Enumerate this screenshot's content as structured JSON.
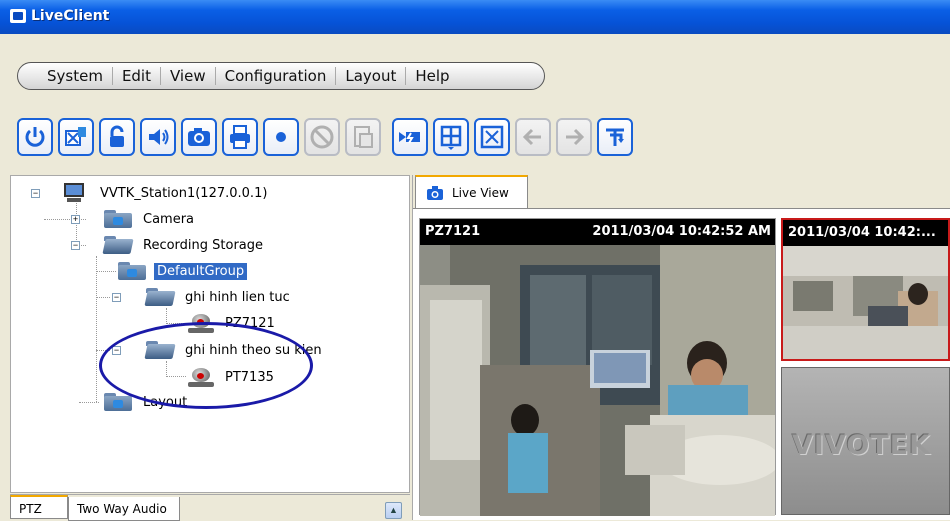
{
  "window": {
    "title": "LiveClient"
  },
  "menu": [
    "System",
    "Edit",
    "View",
    "Configuration",
    "Layout",
    "Help"
  ],
  "toolbar": {
    "buttons": [
      {
        "icon": "power-icon",
        "enabled": true
      },
      {
        "icon": "station-icon",
        "enabled": true
      },
      {
        "icon": "lock-icon",
        "enabled": true
      },
      {
        "icon": "speaker-icon",
        "enabled": true
      },
      {
        "icon": "snapshot-camera-icon",
        "enabled": true
      },
      {
        "icon": "print-icon",
        "enabled": true
      },
      {
        "icon": "record-icon",
        "enabled": true
      },
      {
        "icon": "stop-icon",
        "enabled": false
      },
      {
        "icon": "page-icon",
        "enabled": false
      },
      {
        "icon": "patrol-icon",
        "enabled": true
      },
      {
        "icon": "layout-grid-icon",
        "enabled": true
      },
      {
        "icon": "fullscreen-icon",
        "enabled": true
      },
      {
        "icon": "arrow-left-icon",
        "enabled": false
      },
      {
        "icon": "arrow-right-icon",
        "enabled": false
      },
      {
        "icon": "restore-icon",
        "enabled": true
      }
    ]
  },
  "tree": {
    "station": "VVTK_Station1(127.0.0.1)",
    "camera": "Camera",
    "recording_storage": "Recording Storage",
    "default_group": "DefaultGroup",
    "group_continuous": "ghi hinh lien tuc",
    "device_pz": "PZ7121",
    "group_event": "ghi hinh theo su kien",
    "device_pt": "PT7135",
    "layout": "Layout"
  },
  "bottom_tabs": [
    "PTZ",
    "Two Way Audio"
  ],
  "live_view": {
    "tab_label": "Live View",
    "main_pane": {
      "camera": "PZ7121",
      "timestamp": "2011/03/04 10:42:52 AM"
    },
    "secondary_pane": {
      "timestamp": "2011/03/04 10:42:..."
    },
    "empty_pane_logo": "VIVOTEK"
  },
  "colors": {
    "titlebar": "#0652d6",
    "selection": "#316ac5",
    "active_pane_border": "#c81a1a",
    "annotation": "#1a1aa8",
    "tab_accent": "#f2a800"
  }
}
